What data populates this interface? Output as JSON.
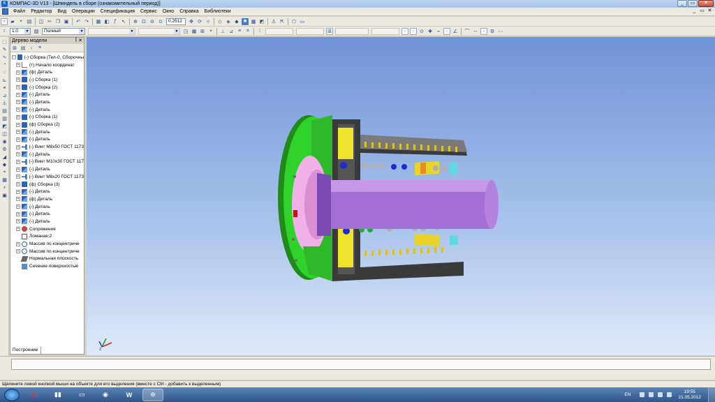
{
  "window": {
    "title": "КОМПАС-3D V13 - [Шпиндель в сборе (ознакомительный период)]",
    "minimize": "_",
    "restore": "▭",
    "close": "✕"
  },
  "menu": {
    "items": [
      "Файл",
      "Редактор",
      "Вид",
      "Операции",
      "Спецификация",
      "Сервис",
      "Окно",
      "Справка",
      "Библиотеки"
    ]
  },
  "toolbar": {
    "zoom_value": "0.2512",
    "scale_value": "1.0",
    "display_mode": "Полный"
  },
  "tree": {
    "title": "Дерево модели",
    "pin": "ꟾ",
    "close": "✕",
    "tab_label": "Построение",
    "items": [
      {
        "label": "(-) Сборка (Тел-0, Сборочны",
        "icon": "assembly-icon",
        "expand": "−"
      },
      {
        "label": "(т) Начало координат",
        "icon": "origin-icon",
        "expand": "+"
      },
      {
        "label": "(ф) Деталь",
        "icon": "part-icon",
        "expand": "+"
      },
      {
        "label": "(-) Сборка (1)",
        "icon": "assembly-icon",
        "expand": "+"
      },
      {
        "label": "(-) Сборка (2)",
        "icon": "assembly-icon",
        "expand": "+"
      },
      {
        "label": "(-) Деталь",
        "icon": "part-icon",
        "expand": "+"
      },
      {
        "label": "(-) Деталь",
        "icon": "part-icon",
        "expand": "+"
      },
      {
        "label": "(-) Деталь",
        "icon": "part-icon",
        "expand": "+"
      },
      {
        "label": "(-) Сборка (1)",
        "icon": "assembly-icon",
        "expand": "+"
      },
      {
        "label": "(ф) Сборка (2)",
        "icon": "assembly-icon",
        "expand": "+"
      },
      {
        "label": "(-) Деталь",
        "icon": "part-icon",
        "expand": "+"
      },
      {
        "label": "(-) Деталь",
        "icon": "part-icon",
        "expand": "+"
      },
      {
        "label": "(-) Винт М8х50 ГОСТ 1173",
        "icon": "screw-icon",
        "expand": "+"
      },
      {
        "label": "(-) Деталь",
        "icon": "part-icon",
        "expand": "+"
      },
      {
        "label": "(-) Винт М10х30 ГОСТ 117",
        "icon": "screw-icon",
        "expand": "+"
      },
      {
        "label": "(-) Деталь",
        "icon": "part-icon",
        "expand": "+"
      },
      {
        "label": "(-) Винт М8х20 ГОСТ 1173",
        "icon": "screw-icon",
        "expand": "+"
      },
      {
        "label": "(ф) Сборка (3)",
        "icon": "assembly-icon",
        "expand": "+"
      },
      {
        "label": "(-) Деталь",
        "icon": "part-icon",
        "expand": "+"
      },
      {
        "label": "(ф) Деталь",
        "icon": "part-icon",
        "expand": "+"
      },
      {
        "label": "(-) Деталь",
        "icon": "part-icon",
        "expand": "+"
      },
      {
        "label": "(-) Деталь",
        "icon": "part-icon",
        "expand": "+"
      },
      {
        "label": "(-) Деталь",
        "icon": "part-icon",
        "expand": "+"
      },
      {
        "label": "Сопряжения",
        "icon": "mate-icon",
        "expand": "+"
      },
      {
        "label": "Ломаная:2",
        "icon": "polyline-icon",
        "expand": ""
      },
      {
        "label": "Массив по концентриче",
        "icon": "array-icon",
        "expand": "+"
      },
      {
        "label": "Массив по концентриче",
        "icon": "array-icon",
        "expand": "+"
      },
      {
        "label": "Нормальная плоскость",
        "icon": "plane-icon",
        "expand": ""
      },
      {
        "label": "Сечение поверхностью",
        "icon": "section-icon",
        "expand": ""
      }
    ]
  },
  "viewport": {
    "triad_z": "Z"
  },
  "statusbar": {
    "hint": "Щелкните левой кнопкой мыши на объекте для его выделения (вместе с Ctrl - добавить к выделенным)"
  },
  "taskbar": {
    "lang": "EN",
    "time": "19:55",
    "date": "21.05.2012"
  }
}
